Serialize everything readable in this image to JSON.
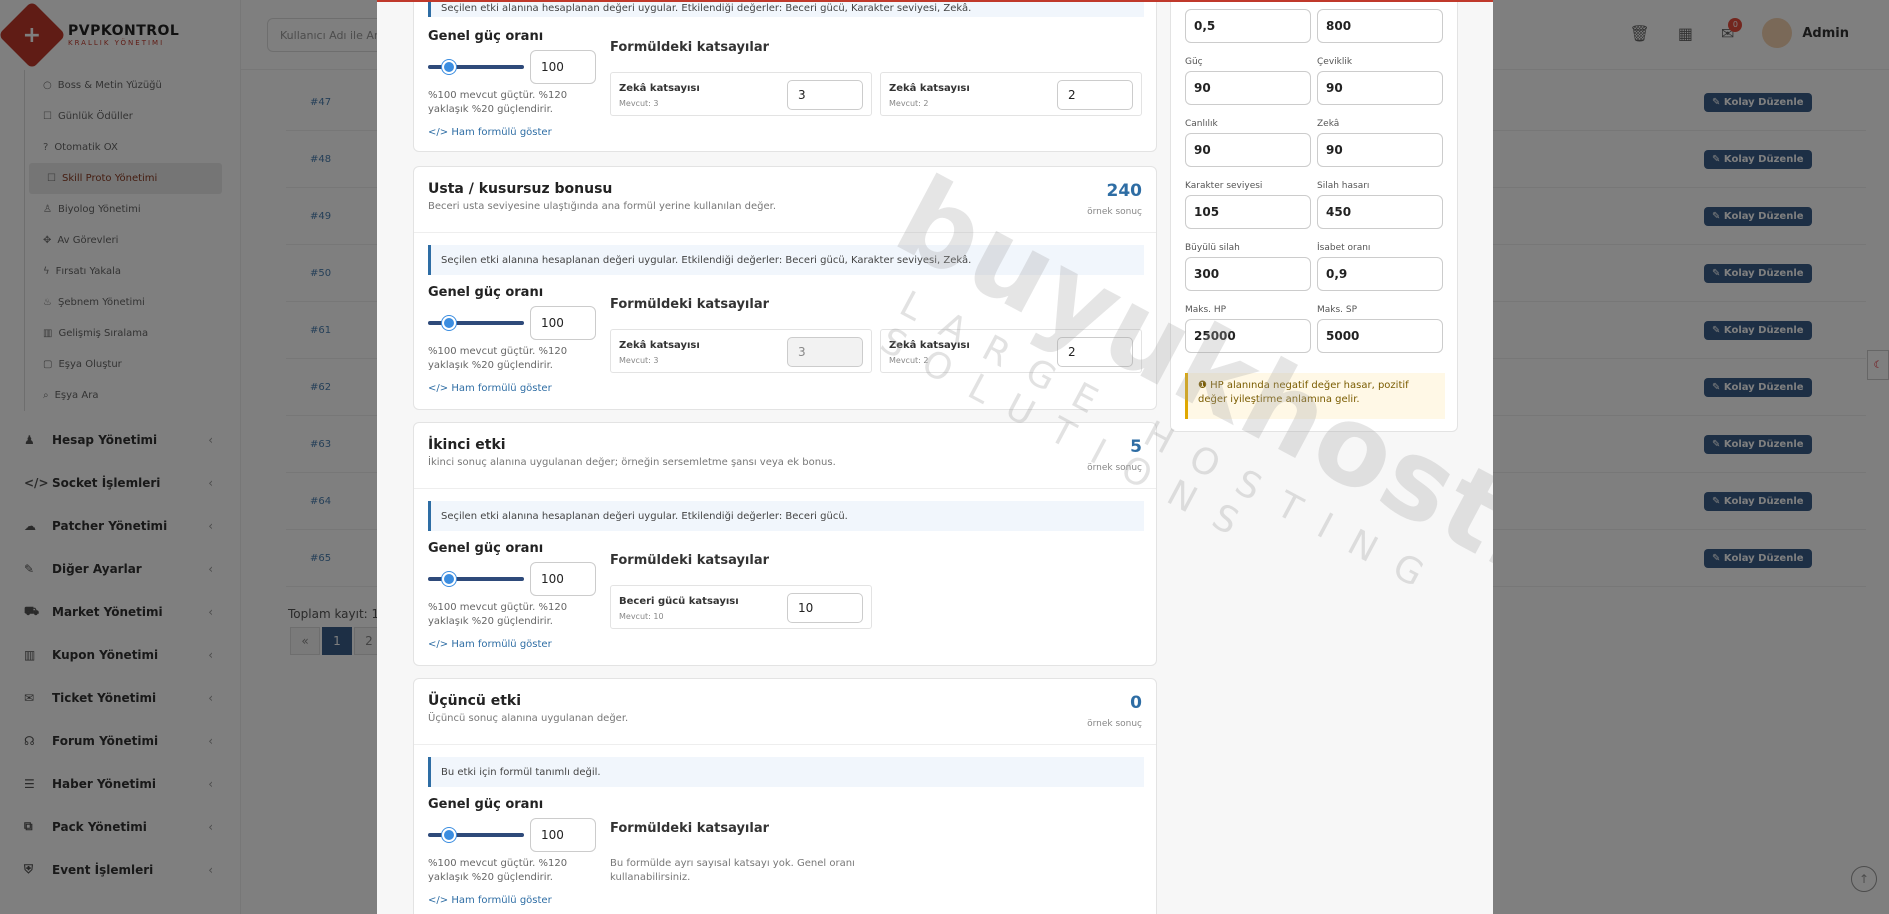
{
  "brand": {
    "name": "PVPKONTROL",
    "subtitle": "KRALLIK YÖNETIMI",
    "logo_glyph": "+"
  },
  "search": {
    "placeholder": "Kullanıcı Adı ile Ara"
  },
  "topbar": {
    "notif_count": "0",
    "user": "Admin",
    "icons": [
      "trash-icon",
      "calendar-icon",
      "mail-icon"
    ]
  },
  "sidebar": {
    "sub_items": [
      {
        "icon": "○",
        "label": "Boss & Metin Yüzüğü"
      },
      {
        "icon": "☐",
        "label": "Günlük Ödüller"
      },
      {
        "icon": "?",
        "label": "Otomatik OX"
      },
      {
        "icon": "☐",
        "label": "Skill Proto Yönetimi"
      },
      {
        "icon": "♙",
        "label": "Biyolog Yönetimi"
      },
      {
        "icon": "✥",
        "label": "Av Görevleri"
      },
      {
        "icon": "ϟ",
        "label": "Fırsatı Yakala"
      },
      {
        "icon": "♨",
        "label": "Şebnem Yönetimi"
      },
      {
        "icon": "▥",
        "label": "Gelişmiş Sıralama"
      },
      {
        "icon": "▢",
        "label": "Eşya Oluştur"
      },
      {
        "icon": "⌕",
        "label": "Eşya Ara"
      }
    ],
    "menu": [
      {
        "icon": "♟",
        "label": "Hesap Yönetimi"
      },
      {
        "icon": "</>",
        "label": "Socket İşlemleri"
      },
      {
        "icon": "☁",
        "label": "Patcher Yönetimi"
      },
      {
        "icon": "✎",
        "label": "Diğer Ayarlar"
      },
      {
        "icon": "⛟",
        "label": "Market Yönetimi"
      },
      {
        "icon": "▥",
        "label": "Kupon Yönetimi"
      },
      {
        "icon": "✉",
        "label": "Ticket Yönetimi"
      },
      {
        "icon": "☊",
        "label": "Forum Yönetimi"
      },
      {
        "icon": "☰",
        "label": "Haber Yönetimi"
      },
      {
        "icon": "⧉",
        "label": "Pack Yönetimi"
      },
      {
        "icon": "⛨",
        "label": "Event İşlemleri"
      }
    ]
  },
  "table": {
    "rows": [
      "#47",
      "#48",
      "#49",
      "#50",
      "#61",
      "#62",
      "#63",
      "#64",
      "#65"
    ],
    "row_button": "Kolay Düzenle",
    "total_label": "Toplam kayıt: 1",
    "pager": [
      "«",
      "1",
      "2"
    ]
  },
  "modal": {
    "top_partial_info": "Seçilen etki alanına hesaplanan değeri uygular. Etkilendiği değerler: Beceri gücü, Karakter seviyesi, Zekâ.",
    "common": {
      "gg_label": "Genel güç oranı",
      "gg_value": "100",
      "gg_note": "%100 mevcut güçtür. %120 yaklaşık %20 güçlendirir.",
      "raw": "Ham formülü göster",
      "coef_title": "Formüldeki katsayılar",
      "sample_label": "örnek sonuç"
    },
    "card0": {
      "coefs": [
        {
          "label": "Zekâ katsayısı",
          "cur": "Mevcut: 3",
          "val": "3",
          "disabled": false
        },
        {
          "label": "Zekâ katsayısı",
          "cur": "Mevcut: 2",
          "val": "2",
          "disabled": false
        }
      ]
    },
    "card1": {
      "title": "Usta / kusursuz bonusu",
      "desc": "Beceri usta seviyesine ulaştığında ana formül yerine kullanılan değer.",
      "result": "240",
      "info": "Seçilen etki alanına hesaplanan değeri uygular. Etkilendiği değerler: Beceri gücü, Karakter seviyesi, Zekâ.",
      "coefs": [
        {
          "label": "Zekâ katsayısı",
          "cur": "Mevcut: 3",
          "val": "3",
          "disabled": true
        },
        {
          "label": "Zekâ katsayısı",
          "cur": "Mevcut: 2",
          "val": "2",
          "disabled": false
        }
      ]
    },
    "card2": {
      "title": "İkinci etki",
      "desc": "İkinci sonuç alanına uygulanan değer; örneğin sersemletme şansı veya ek bonus.",
      "result": "5",
      "info": "Seçilen etki alanına hesaplanan değeri uygular. Etkilendiği değerler: Beceri gücü.",
      "coefs": [
        {
          "label": "Beceri gücü katsayısı",
          "cur": "Mevcut: 10",
          "val": "10",
          "disabled": false
        }
      ]
    },
    "card3": {
      "title": "Üçüncü etki",
      "desc": "Üçüncü sonuç alanına uygulanan değer.",
      "result": "0",
      "info": "Bu etki için formül tanımlı değil.",
      "no_coef": "Bu formülde ayrı sayısal katsayı yok. Genel oranı kullanabilirsiniz."
    },
    "side": {
      "fields": [
        {
          "label": "",
          "value": "0,5"
        },
        {
          "label": "",
          "value": "800"
        },
        {
          "label": "Güç",
          "value": "90"
        },
        {
          "label": "Çeviklik",
          "value": "90"
        },
        {
          "label": "Canlılık",
          "value": "90"
        },
        {
          "label": "Zekâ",
          "value": "90"
        },
        {
          "label": "Karakter seviyesi",
          "value": "105"
        },
        {
          "label": "Silah hasarı",
          "value": "450"
        },
        {
          "label": "Büyülü silah",
          "value": "300"
        },
        {
          "label": "İsabet oranı",
          "value": "0,9"
        },
        {
          "label": "Maks. HP",
          "value": "25000"
        },
        {
          "label": "Maks. SP",
          "value": "5000"
        }
      ],
      "warning": "HP alanında negatif değer hasar, pozitif değer iyileştirme anlamına gelir."
    }
  },
  "watermark": {
    "main": "buyukhosting",
    "sub": "LARGE HOSTING SOLUTIONS"
  }
}
